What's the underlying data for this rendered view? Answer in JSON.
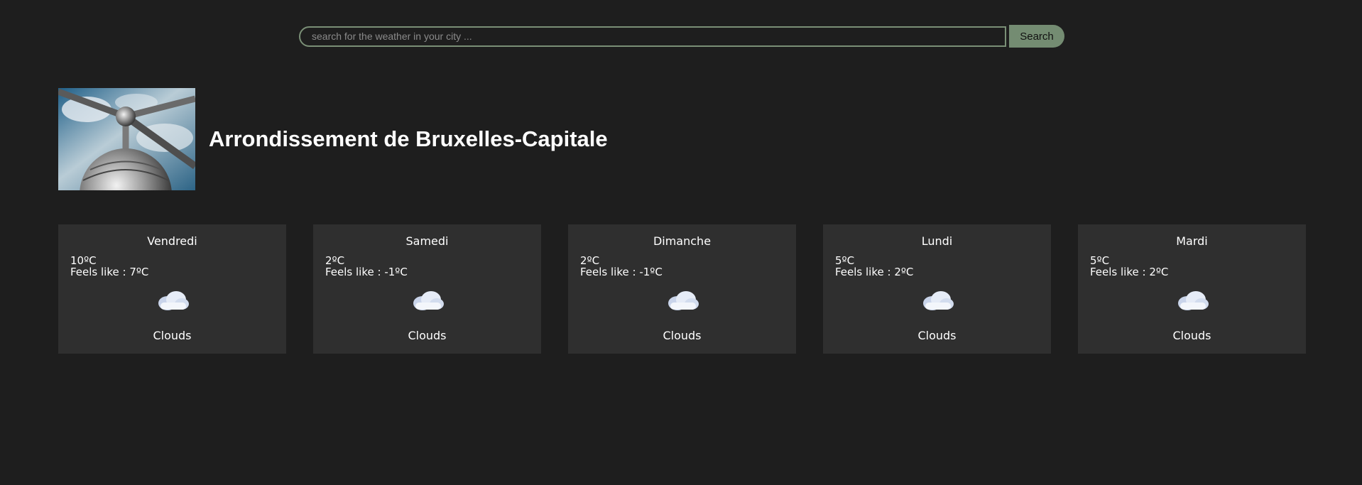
{
  "search": {
    "placeholder": "search for the weather in your city ...",
    "value": "",
    "button_label": "Search"
  },
  "city": {
    "name": "Arrondissement de Bruxelles-Capitale"
  },
  "forecast": [
    {
      "day": "Vendredi",
      "temp": "10ºC",
      "feels_like": "Feels like : 7ºC",
      "icon": "cloud-icon",
      "condition": "Clouds"
    },
    {
      "day": "Samedi",
      "temp": "2ºC",
      "feels_like": "Feels like : -1ºC",
      "icon": "cloud-icon",
      "condition": "Clouds"
    },
    {
      "day": "Dimanche",
      "temp": "2ºC",
      "feels_like": "Feels like : -1ºC",
      "icon": "cloud-icon",
      "condition": "Clouds"
    },
    {
      "day": "Lundi",
      "temp": "5ºC",
      "feels_like": "Feels like : 2ºC",
      "icon": "cloud-icon",
      "condition": "Clouds"
    },
    {
      "day": "Mardi",
      "temp": "5ºC",
      "feels_like": "Feels like : 2ºC",
      "icon": "cloud-icon",
      "condition": "Clouds"
    }
  ],
  "colors": {
    "background": "#1e1e1e",
    "card": "#2f2f2f",
    "accent": "#748c72"
  }
}
